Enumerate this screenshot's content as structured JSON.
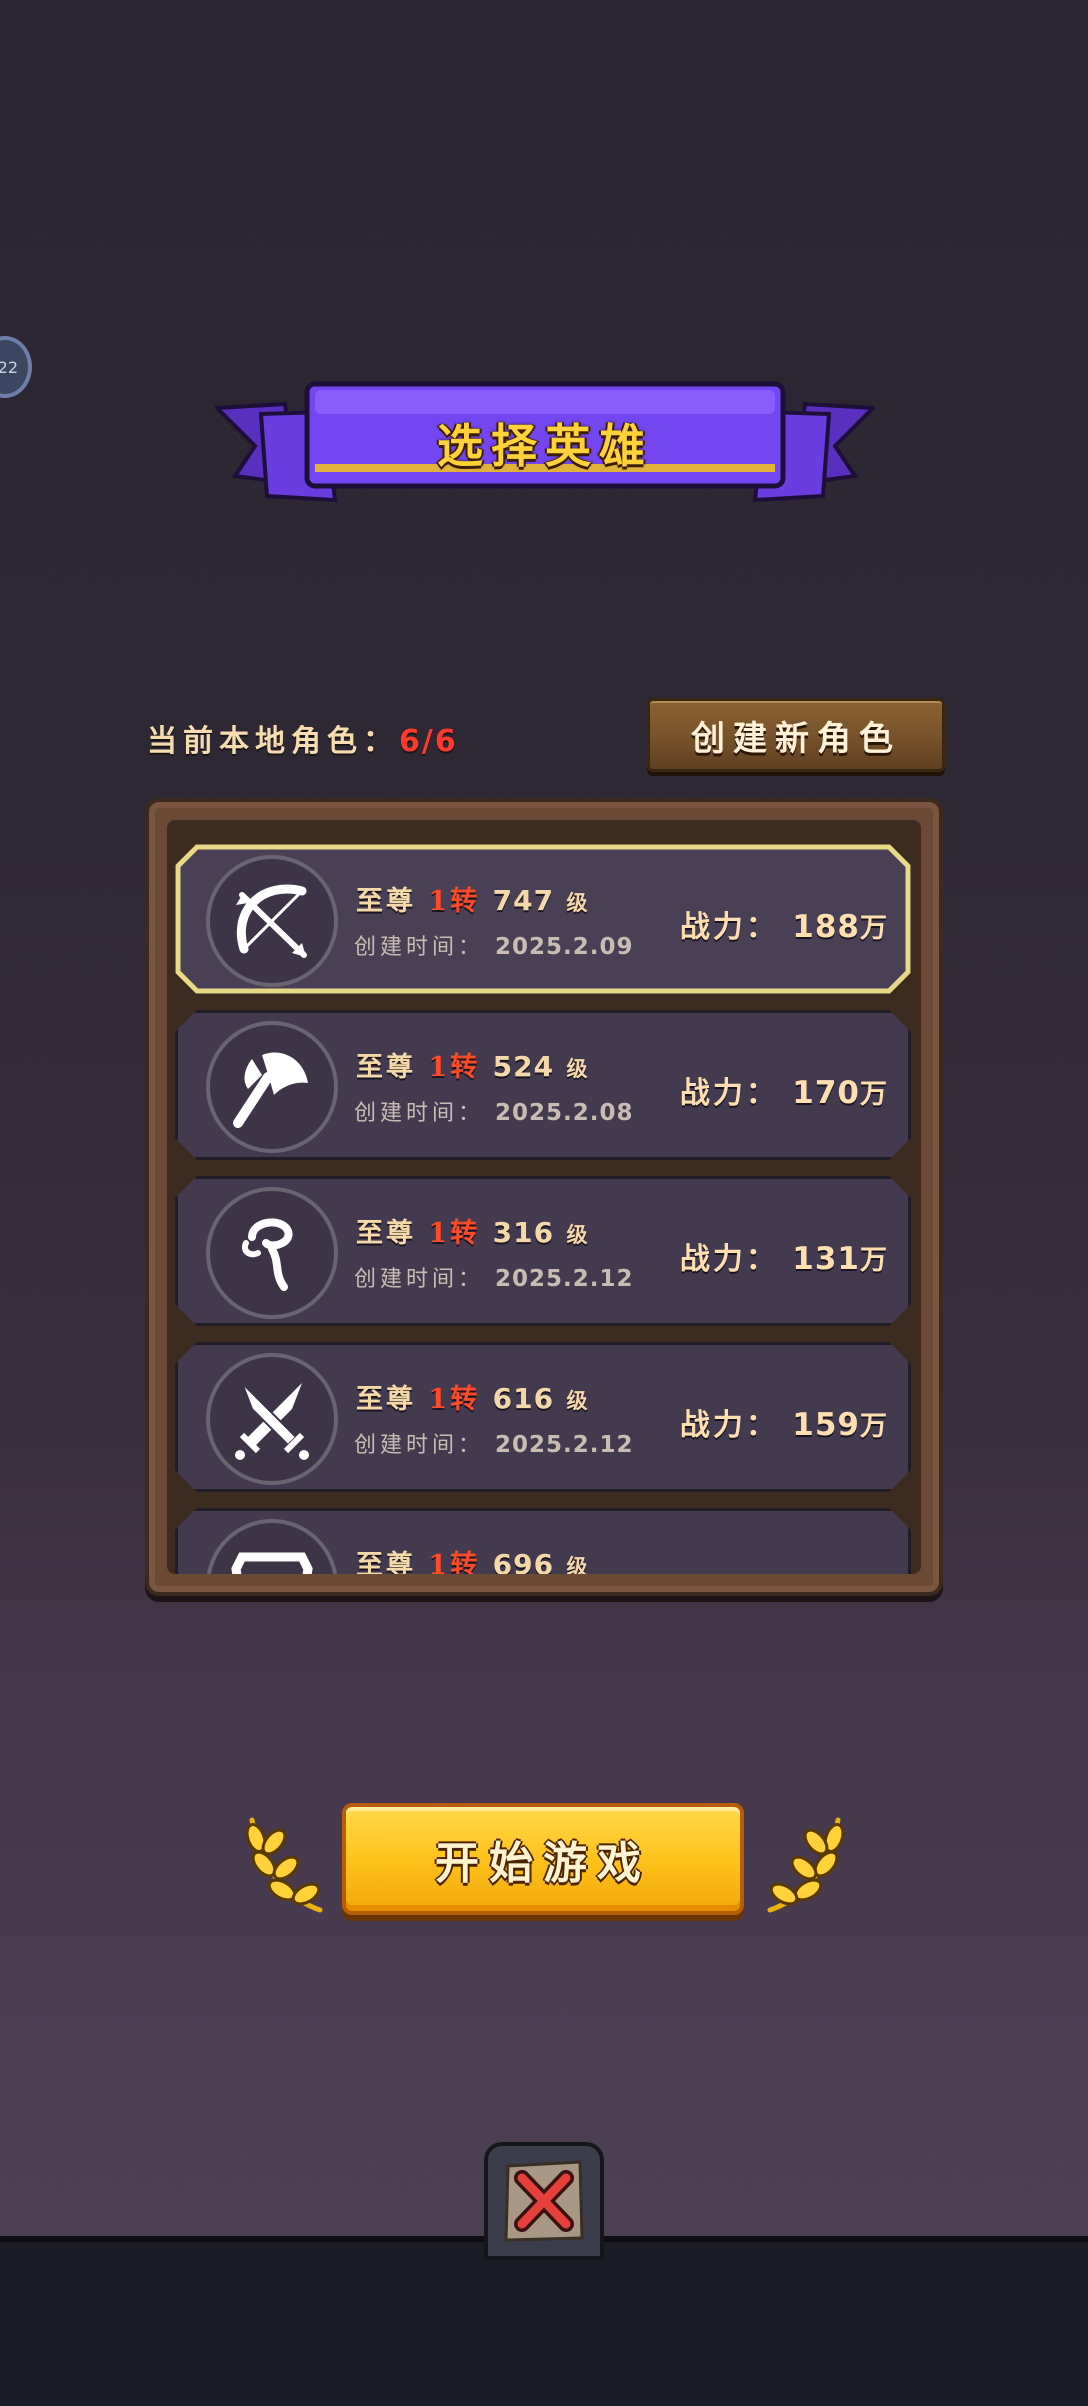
{
  "side_bubble_text": "22",
  "title": "选择英雄",
  "local_roles": {
    "label": "当前本地角色：",
    "count": "6/6"
  },
  "create_button": "创建新角色",
  "roles": [
    {
      "icon": "bow-icon",
      "rank": "至尊",
      "rebirth": "1转",
      "level": "747",
      "level_suffix": "级",
      "created_label": "创建时间：",
      "created": "2025.2.09",
      "power_label": "战力：",
      "power": "188",
      "power_unit": "万",
      "selected": true
    },
    {
      "icon": "axe-icon",
      "rank": "至尊",
      "rebirth": "1转",
      "level": "524",
      "level_suffix": "级",
      "created_label": "创建时间：",
      "created": "2025.2.08",
      "power_label": "战力：",
      "power": "170",
      "power_unit": "万"
    },
    {
      "icon": "staff-icon",
      "rank": "至尊",
      "rebirth": "1转",
      "level": "316",
      "level_suffix": "级",
      "created_label": "创建时间：",
      "created": "2025.2.12",
      "power_label": "战力：",
      "power": "131",
      "power_unit": "万"
    },
    {
      "icon": "crossed-swords-icon",
      "rank": "至尊",
      "rebirth": "1转",
      "level": "616",
      "level_suffix": "级",
      "created_label": "创建时间：",
      "created": "2025.2.12",
      "power_label": "战力：",
      "power": "159",
      "power_unit": "万"
    },
    {
      "icon": "shield-icon",
      "rank": "至尊",
      "rebirth": "1转",
      "level": "696",
      "level_suffix": "级"
    }
  ],
  "start_button": "开始游戏",
  "colors": {
    "accent_gold": "#ffc21c",
    "ribbon_purple": "#6a3fd8",
    "level_red": "#ff4a26"
  }
}
